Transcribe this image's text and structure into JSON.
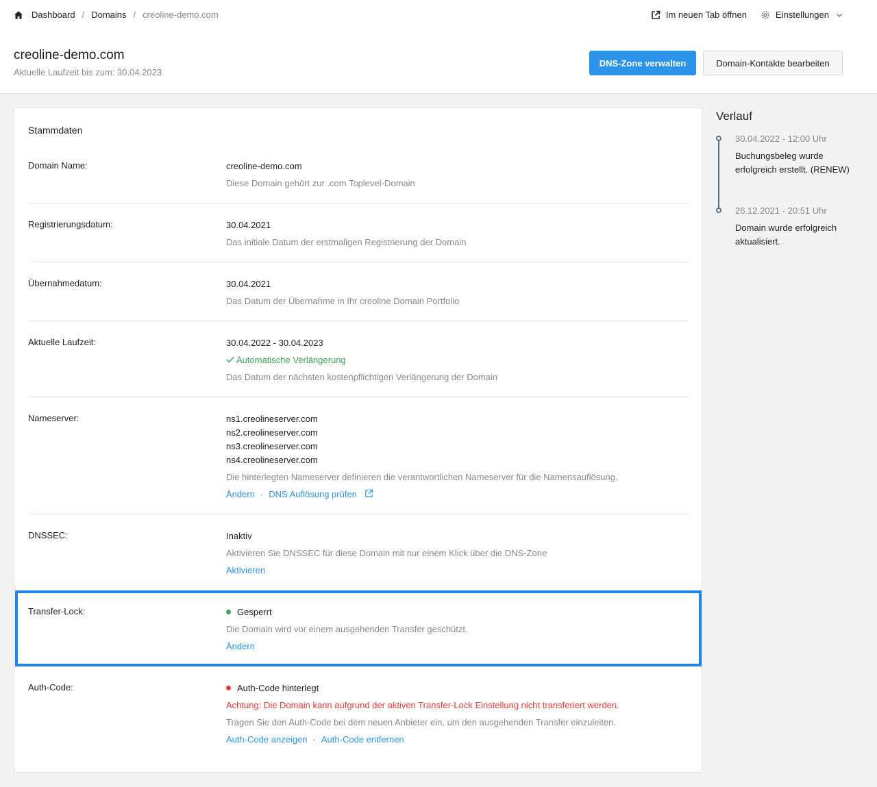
{
  "breadcrumb": {
    "home_icon": "home-icon",
    "dashboard": "Dashboard",
    "sep": "/",
    "domains": "Domains",
    "current": "creoline-demo.com"
  },
  "top_actions": {
    "new_tab": "Im neuen Tab öffnen",
    "settings": "Einstellungen"
  },
  "header": {
    "title": "creoline-demo.com",
    "subtitle": "Aktuelle Laufzeit bis zum: 30.04.2023",
    "dns_button": "DNS-Zone verwalten",
    "contacts_button": "Domain-Kontakte bearbeiten"
  },
  "colors": {
    "accent": "#2b93e8",
    "highlight_border": "#1f85e8",
    "success": "#3aa454",
    "danger": "#e53935"
  },
  "card": {
    "title": "Stammdaten",
    "domain_name": {
      "label": "Domain Name:",
      "value": "creoline-demo.com",
      "desc": "Diese Domain gehört zur .com Toplevel-Domain"
    },
    "registration": {
      "label": "Registrierungsdatum:",
      "value": "30.04.2021",
      "desc": "Das initiale Datum der erstmaligen Registrierung der Domain"
    },
    "takeover": {
      "label": "Übernahmedatum:",
      "value": "30.04.2021",
      "desc": "Das Datum der Übernahme in Ihr creoline Domain Portfolio"
    },
    "runtime": {
      "label": "Aktuelle Laufzeit:",
      "value": "30.04.2022 - 30.04.2023",
      "auto_renew": "Automatische Verlängerung",
      "desc": "Das Datum der nächsten kostenpflichtigen Verlängerung der Domain"
    },
    "nameserver": {
      "label": "Nameserver:",
      "servers": [
        "ns1.creolineserver.com",
        "ns2.creolineserver.com",
        "ns3.creolineserver.com",
        "ns4.creolineserver.com"
      ],
      "desc": "Die hinterlegten Nameserver definieren die verantwortlichen Nameserver für die Namensauflösung.",
      "change": "Ändern",
      "dot": "·",
      "check": "DNS Auflösung prüfen"
    },
    "dnssec": {
      "label": "DNSSEC:",
      "value": "Inaktiv",
      "desc": "Aktivieren Sie DNSSEC für diese Domain mit nur einem Klick über die DNS-Zone",
      "activate": "Aktivieren"
    },
    "transfer_lock": {
      "label": "Transfer-Lock:",
      "value": "Gesperrt",
      "desc": "Die Domain wird vor einem ausgehenden Transfer geschützt.",
      "change": "Ändern",
      "dot_color": "#3aa454"
    },
    "auth_code": {
      "label": "Auth-Code:",
      "value": "Auth-Code hinterlegt",
      "warning": "Achtung: Die Domain kann aufgrund der aktiven Transfer-Lock Einstellung nicht transferiert werden.",
      "desc": "Tragen Sie den Auth-Code bei dem neuen Anbieter ein, um den ausgehenden Transfer einzuleiten.",
      "show": "Auth-Code anzeigen",
      "dot": "·",
      "remove": "Auth-Code entfernen",
      "dot_color": "#e53935"
    }
  },
  "history": {
    "title": "Verlauf",
    "items": [
      {
        "date": "30.04.2022 - 12:00 Uhr",
        "text": "Buchungsbeleg wurde erfolgreich erstellt. (RENEW)"
      },
      {
        "date": "26.12.2021 - 20:51 Uhr",
        "text": "Domain wurde erfolgreich aktualisiert."
      }
    ]
  }
}
